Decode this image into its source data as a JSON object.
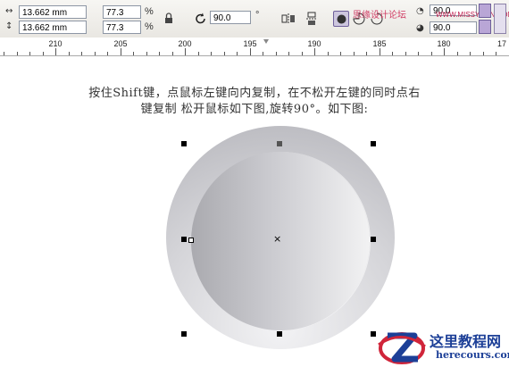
{
  "toolbar": {
    "width_value": "13.662 mm",
    "height_value": "13.662 mm",
    "scale_x": "77.3",
    "scale_y": "77.3",
    "percent_symbol": "%",
    "rotation_value": "90.0",
    "degree_symbol": "°",
    "right_rotation_value_top": "90.0",
    "right_rotation_value_bottom": "90.0",
    "watermark_text": "思缘设计论坛",
    "watermark_url": "WWW.MISSYUAN.COM"
  },
  "ruler": {
    "labels": [
      "210",
      "205",
      "200",
      "195",
      "190",
      "185",
      "180",
      "17"
    ]
  },
  "canvas": {
    "instruction_line1": "按住Shift键，点鼠标左键向内复制，在不松开左键的同时点右",
    "instruction_line2": "键复制 松开鼠标如下图,旋转90°。如下图:",
    "center_mark": "×"
  },
  "logo": {
    "title": "这里教程网",
    "url": "herecours.com"
  },
  "colors": {
    "logo_blue": "#1c3f97",
    "logo_red": "#d0253a",
    "watermark": "#d03b63"
  }
}
